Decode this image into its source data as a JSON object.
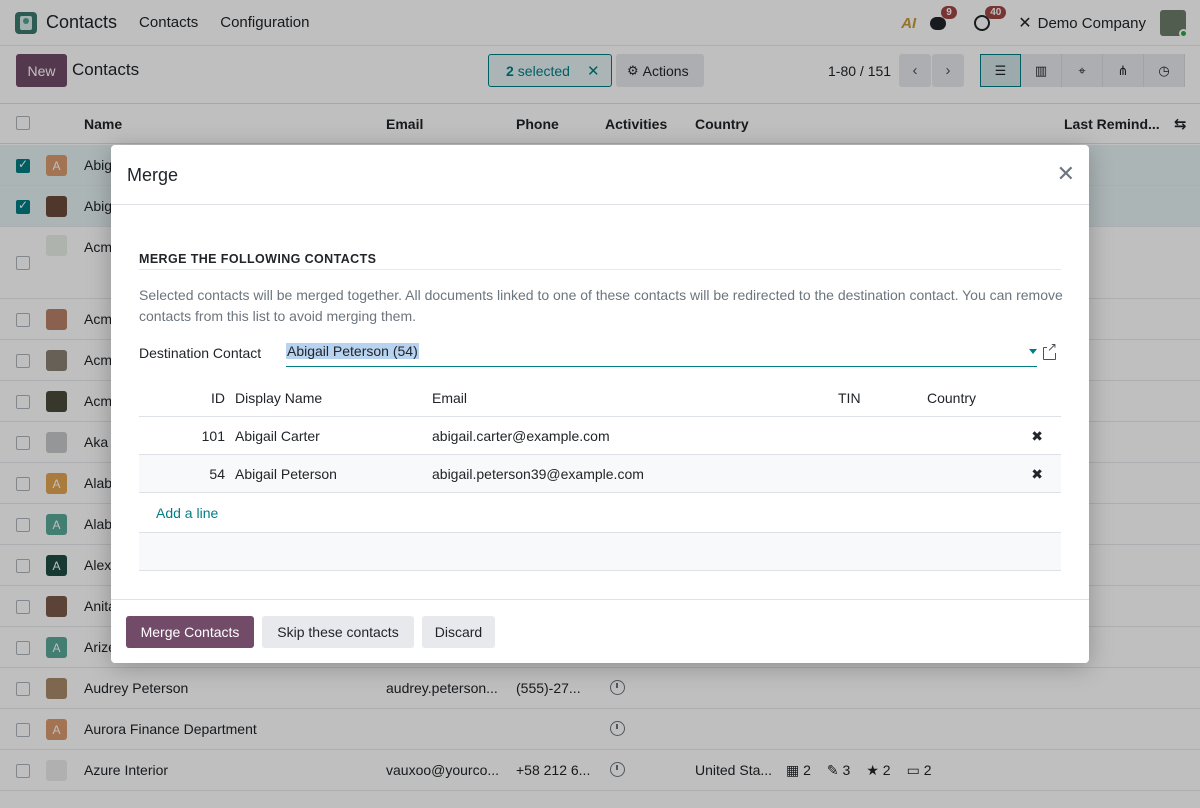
{
  "navbar": {
    "app_name": "Contacts",
    "menu": [
      "Contacts",
      "Configuration"
    ],
    "ai_label": "AI",
    "messages_count": "9",
    "activities_count": "40",
    "company": "Demo Company"
  },
  "control": {
    "new_label": "New",
    "breadcrumb": "Contacts",
    "selected_count": "2",
    "selected_label": "selected",
    "actions_label": "Actions",
    "pager": "1-80 / 151"
  },
  "list": {
    "headers": {
      "name": "Name",
      "email": "Email",
      "phone": "Phone",
      "activities": "Activities",
      "country": "Country",
      "last_reminder": "Last Remind..."
    },
    "rows": [
      {
        "name": "Abig",
        "avatar": "A",
        "color": "#d99b70",
        "selected": true
      },
      {
        "name": "Abig",
        "avatar": "",
        "color": "#6b4a3a",
        "selected": true
      },
      {
        "name": "Acm",
        "avatar": "",
        "color": "#e9efe9",
        "selected": false
      },
      {
        "name": "Acm",
        "avatar": "",
        "color": "#b9816a",
        "selected": false
      },
      {
        "name": "Acm",
        "avatar": "",
        "color": "#8a8074",
        "selected": false
      },
      {
        "name": "Acm",
        "avatar": "",
        "color": "#4a4a3a",
        "selected": false
      },
      {
        "name": "Aka",
        "avatar": "",
        "color": "#c7c9cb",
        "selected": false
      },
      {
        "name": "Alab",
        "avatar": "A",
        "color": "#e2a550",
        "selected": false
      },
      {
        "name": "Alab",
        "avatar": "A",
        "color": "#5aa89a",
        "selected": false
      },
      {
        "name": "Alex",
        "avatar": "A",
        "color": "#1e4d43",
        "selected": false
      },
      {
        "name": "Anita",
        "avatar": "",
        "color": "#7a5a4a",
        "selected": false
      },
      {
        "name": "Arize",
        "avatar": "A",
        "color": "#5aa89a",
        "selected": false
      },
      {
        "name": "Audrey Peterson",
        "email": "audrey.peterson...",
        "phone": "(555)-27...",
        "avatar": "",
        "color": "#a88a6a",
        "selected": false
      },
      {
        "name": "Aurora Finance Department",
        "avatar": "A",
        "color": "#d99b70",
        "selected": false
      },
      {
        "name": "Azure Interior",
        "email": "vauxoo@yourco...",
        "phone": "+58 212 6...",
        "country": "United Sta...",
        "avatar": "",
        "color": "#ebebeb",
        "selected": false,
        "counts": [
          "2",
          "3",
          "2",
          "2"
        ]
      }
    ]
  },
  "dialog": {
    "title": "Merge",
    "section_title": "MERGE THE FOLLOWING CONTACTS",
    "description": "Selected contacts will be merged together. All documents linked to one of these contacts will be redirected to the destination contact. You can remove contacts from this list to avoid merging them.",
    "destination_label": "Destination Contact",
    "destination_value": "Abigail Peterson (54)",
    "table": {
      "headers": [
        "ID",
        "Display Name",
        "Email",
        "TIN",
        "Country"
      ],
      "rows": [
        {
          "id": "101",
          "name": "Abigail Carter",
          "email": "abigail.carter@example.com",
          "tin": "",
          "country": ""
        },
        {
          "id": "54",
          "name": "Abigail Peterson",
          "email": "abigail.peterson39@example.com",
          "tin": "",
          "country": ""
        }
      ],
      "add_line": "Add a line"
    },
    "buttons": {
      "merge": "Merge Contacts",
      "skip": "Skip these contacts",
      "discard": "Discard"
    }
  }
}
